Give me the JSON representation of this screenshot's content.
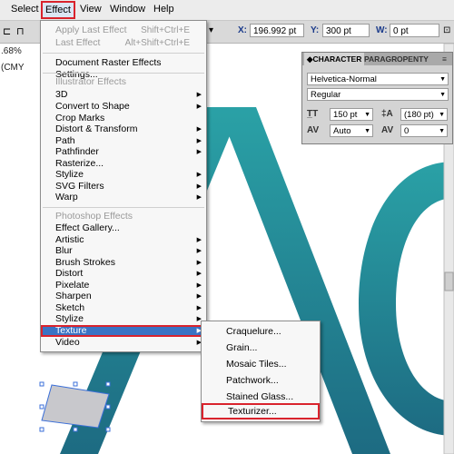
{
  "menubar": {
    "items": [
      "Select",
      "Effect",
      "View",
      "Window",
      "Help"
    ]
  },
  "control_bar": {
    "x_label": "X:",
    "x_value": "196.992 pt",
    "y_label": "Y:",
    "y_value": "300 pt",
    "w_label": "W:",
    "w_value": "0 pt"
  },
  "document_tab": ".68% (CMY",
  "effect_menu": {
    "apply_last": {
      "label": "Apply Last Effect",
      "shortcut": "Shift+Ctrl+E"
    },
    "last_effect": {
      "label": "Last Effect",
      "shortcut": "Alt+Shift+Ctrl+E"
    },
    "doc_raster": "Document Raster Effects Settings...",
    "illustrator_header": "Illustrator Effects",
    "illustrator_items": [
      "3D",
      "Convert to Shape",
      "Crop Marks",
      "Distort & Transform",
      "Path",
      "Pathfinder",
      "Rasterize...",
      "Stylize",
      "SVG Filters",
      "Warp"
    ],
    "photoshop_header": "Photoshop Effects",
    "photoshop_items": [
      "Effect Gallery...",
      "Artistic",
      "Blur",
      "Brush Strokes",
      "Distort",
      "Pixelate",
      "Sharpen",
      "Sketch",
      "Stylize",
      "Texture",
      "Video"
    ]
  },
  "texture_submenu": {
    "items": [
      "Craquelure...",
      "Grain...",
      "Mosaic Tiles...",
      "Patchwork...",
      "Stained Glass...",
      "Texturizer..."
    ]
  },
  "character_panel": {
    "tabs": [
      "◆CHARACTER",
      "PARAGR",
      "OPENTY"
    ],
    "font_family": "Helvetica-Normal",
    "font_style": "Regular",
    "font_size": "150 pt",
    "leading": "(180 pt)",
    "kerning": "Auto",
    "tracking": "0"
  },
  "colors": {
    "menu_highlight": "#3a73c4",
    "annotation_red": "#d9232d",
    "art_teal_top": "#2aa1a6",
    "art_teal_bottom": "#1d6b82"
  },
  "icons": [
    "align-left-icon",
    "align-center-icon",
    "submenu-arrow-icon",
    "font-size-icon",
    "leading-icon",
    "kerning-icon",
    "tracking-icon",
    "scroll-up-icon",
    "scroll-down-icon"
  ]
}
